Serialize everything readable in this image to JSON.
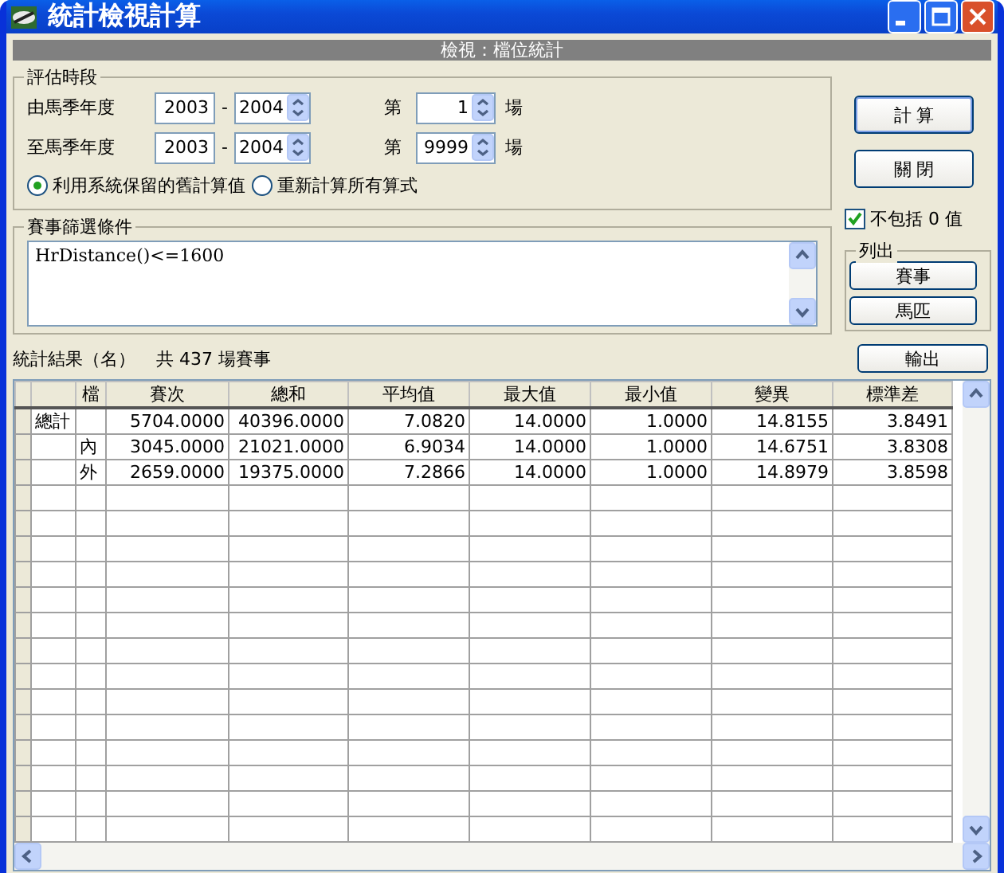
{
  "window": {
    "title": "統計檢視計算"
  },
  "view_banner": "檢視：檔位統計",
  "period": {
    "title": "評估時段",
    "ranges": [
      {
        "label": "由馬季年度",
        "season_from": "2003",
        "dash": "-",
        "season_to": "2004",
        "race_prefix": "第",
        "race": "1",
        "race_suffix": "場"
      },
      {
        "label": "至馬季年度",
        "season_from": "2003",
        "dash": "-",
        "season_to": "2004",
        "race_prefix": "第",
        "race": "9999",
        "race_suffix": "場"
      }
    ],
    "options": [
      {
        "label": "利用系統保留的舊計算值",
        "selected": true
      },
      {
        "label": "重新計算所有算式",
        "selected": false
      }
    ]
  },
  "filter": {
    "title": "賽事篩選條件",
    "value": "HrDistance()<=1600"
  },
  "buttons": {
    "calculate": "計 算",
    "close": "關 閉",
    "export": "輸出"
  },
  "exclude_zero": {
    "label": "不包括 0 值",
    "checked": true
  },
  "list_out": {
    "title": "列出",
    "buttons": [
      "賽事",
      "馬匹"
    ]
  },
  "results": {
    "label": "統計結果（名）",
    "count": "共 437 場賽事"
  },
  "table": {
    "columns": [
      "檔",
      "賽次",
      "總和",
      "平均值",
      "最大值",
      "最小值",
      "變異",
      "標準差"
    ],
    "rows": [
      {
        "group": "總計",
        "values": [
          "5704.0000",
          "40396.0000",
          "7.0820",
          "14.0000",
          "1.0000",
          "14.8155",
          "3.8491"
        ]
      },
      {
        "gate": "內",
        "values": [
          "3045.0000",
          "21021.0000",
          "6.9034",
          "14.0000",
          "1.0000",
          "14.6751",
          "3.8308"
        ]
      },
      {
        "gate": "外",
        "values": [
          "2659.0000",
          "19375.0000",
          "7.2866",
          "14.0000",
          "1.0000",
          "14.8979",
          "3.8598"
        ]
      }
    ]
  }
}
